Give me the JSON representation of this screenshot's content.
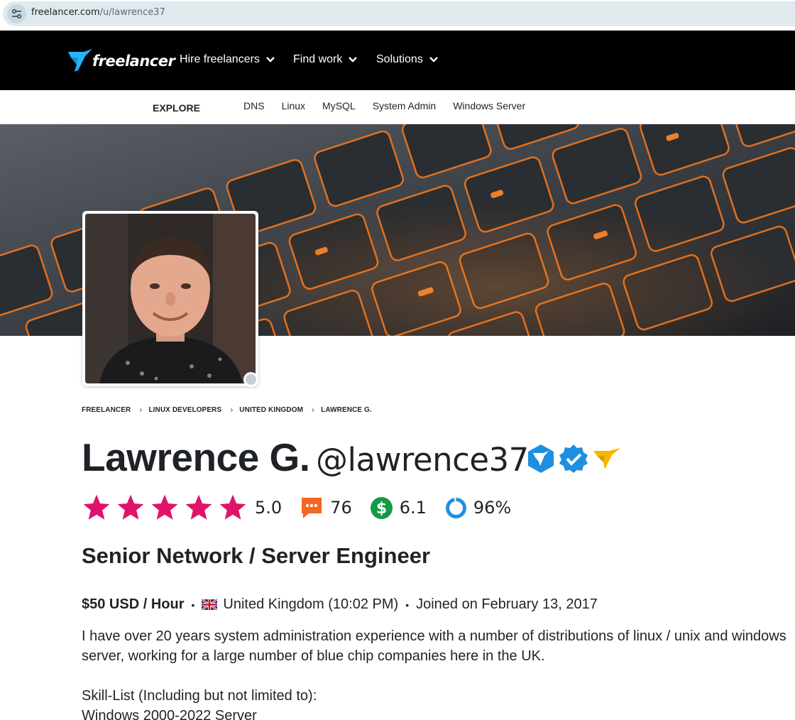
{
  "browser": {
    "url_domain": "freelancer.com",
    "url_path": "/u/lawrence37"
  },
  "nav": {
    "logo_text": "freelancer",
    "items": [
      {
        "label": "Hire freelancers"
      },
      {
        "label": "Find work"
      },
      {
        "label": "Solutions"
      }
    ]
  },
  "explore": {
    "label": "EXPLORE",
    "links": [
      "DNS",
      "Linux",
      "MySQL",
      "System Admin",
      "Windows Server"
    ]
  },
  "breadcrumb": [
    "FREELANCER",
    "LINUX DEVELOPERS",
    "UNITED KINGDOM",
    "LAWRENCE G."
  ],
  "profile": {
    "name": "Lawrence G.",
    "username": "@lawrence37",
    "rating": "5.0",
    "rating_stars": 5,
    "reviews": "76",
    "earnings_score": "6.1",
    "completion": "96%",
    "completion_fraction": 0.96,
    "headline": "Senior Network / Server Engineer",
    "rate": "$50 USD / Hour",
    "location": "United Kingdom (10:02 PM)",
    "joined": "Joined on February 13, 2017",
    "description": [
      "I have over 20 years system administration experience with a number of distributions of linux / unix and windows",
      "server, working for a large number of blue chip companies here in the UK.",
      "",
      "Skill-List (Including but not limited to):",
      "Windows 2000-2022 Server"
    ]
  },
  "colors": {
    "star": "#e0136c",
    "review_icon": "#f26522",
    "earnings_icon": "#139a43",
    "completion_ring": "#1f8fe0",
    "badge_blue": "#1f8fe0",
    "badge_gold": "#f7b500",
    "nav_bg": "#000000",
    "logo_blue": "#29b2fe"
  },
  "icons": {
    "site_info": "tune-icon",
    "chevron": "chevron-down-icon",
    "reviews": "chat-bubble-icon",
    "earnings": "dollar-icon",
    "completion": "progress-ring-icon",
    "badges": [
      "freelancer-shield-badge-icon",
      "verified-check-badge-icon",
      "preferred-freelancer-bird-icon"
    ]
  }
}
